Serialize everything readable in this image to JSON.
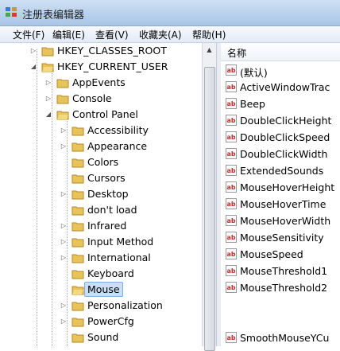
{
  "window": {
    "title": "注册表编辑器"
  },
  "menu": [
    "文件(F)",
    "编辑(E)",
    "查看(V)",
    "收藏夹(A)",
    "帮助(H)"
  ],
  "tree": {
    "root_hkcr": "HKEY_CLASSES_ROOT",
    "root_hkcu": "HKEY_CURRENT_USER",
    "hkcu_children": [
      "AppEvents",
      "Console",
      "Control Panel"
    ],
    "control_panel_children": [
      "Accessibility",
      "Appearance",
      "Colors",
      "Cursors",
      "Desktop",
      "don't load",
      "Infrared",
      "Input Method",
      "International",
      "Keyboard",
      "Mouse",
      "Personalization",
      "PowerCfg",
      "Sound"
    ],
    "selected": "Mouse"
  },
  "values": {
    "column_name": "名称",
    "items": [
      "(默认)",
      "ActiveWindowTrac",
      "Beep",
      "DoubleClickHeight",
      "DoubleClickSpeed",
      "DoubleClickWidth",
      "ExtendedSounds",
      "MouseHoverHeight",
      "MouseHoverTime",
      "MouseHoverWidth",
      "MouseSensitivity",
      "MouseSpeed",
      "MouseThreshold1",
      "MouseThreshold2",
      "SmoothMouseYCu"
    ]
  }
}
